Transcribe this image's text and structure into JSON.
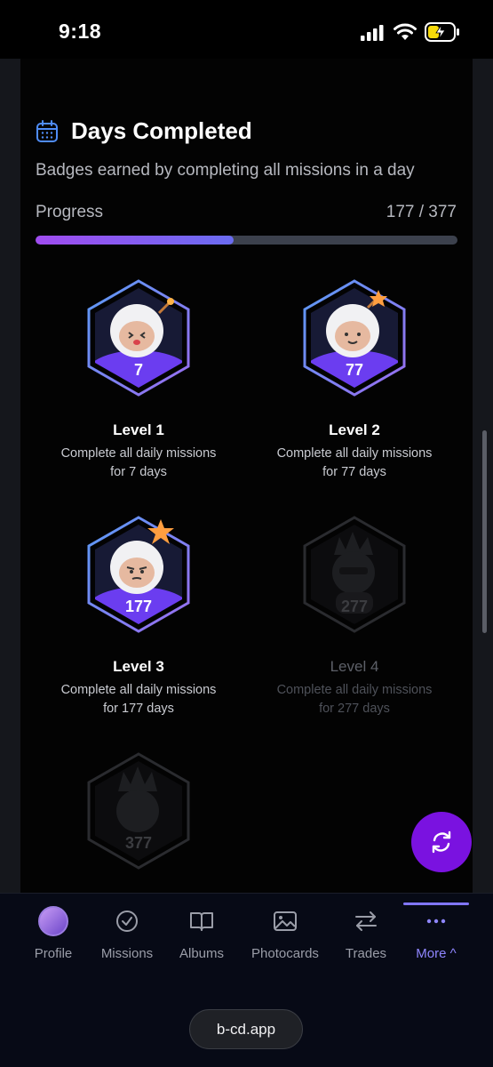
{
  "status_bar": {
    "time": "9:18"
  },
  "section": {
    "title": "Days Completed",
    "subtitle": "Badges earned by completing all missions in a day",
    "progress_label": "Progress",
    "progress_value": "177 / 377",
    "progress_fraction": 0.47
  },
  "badges": [
    {
      "number": "7",
      "title": "Level 1",
      "desc": "Complete all daily missions for 7 days",
      "earned": true
    },
    {
      "number": "77",
      "title": "Level 2",
      "desc": "Complete all daily missions for 77 days",
      "earned": true
    },
    {
      "number": "177",
      "title": "Level 3",
      "desc": "Complete all daily missions for 177 days",
      "earned": true
    },
    {
      "number": "277",
      "title": "Level 4",
      "desc": "Complete all daily missions for 277 days",
      "earned": false
    },
    {
      "number": "377",
      "earned": false
    }
  ],
  "nav": {
    "items": [
      {
        "label": "Profile",
        "icon": "avatar"
      },
      {
        "label": "Missions",
        "icon": "check-circle-icon"
      },
      {
        "label": "Albums",
        "icon": "book-icon"
      },
      {
        "label": "Photocards",
        "icon": "image-icon"
      },
      {
        "label": "Trades",
        "icon": "swap-arrows-icon"
      },
      {
        "label": "More ^",
        "icon": "more-dots-icon",
        "active": true
      }
    ]
  },
  "browser": {
    "url": "b-cd.app"
  },
  "colors": {
    "accent": "#7a12e0",
    "progress_start": "#a04cf0",
    "progress_end": "#6a6cf2",
    "nav_active": "#8f86ff"
  }
}
